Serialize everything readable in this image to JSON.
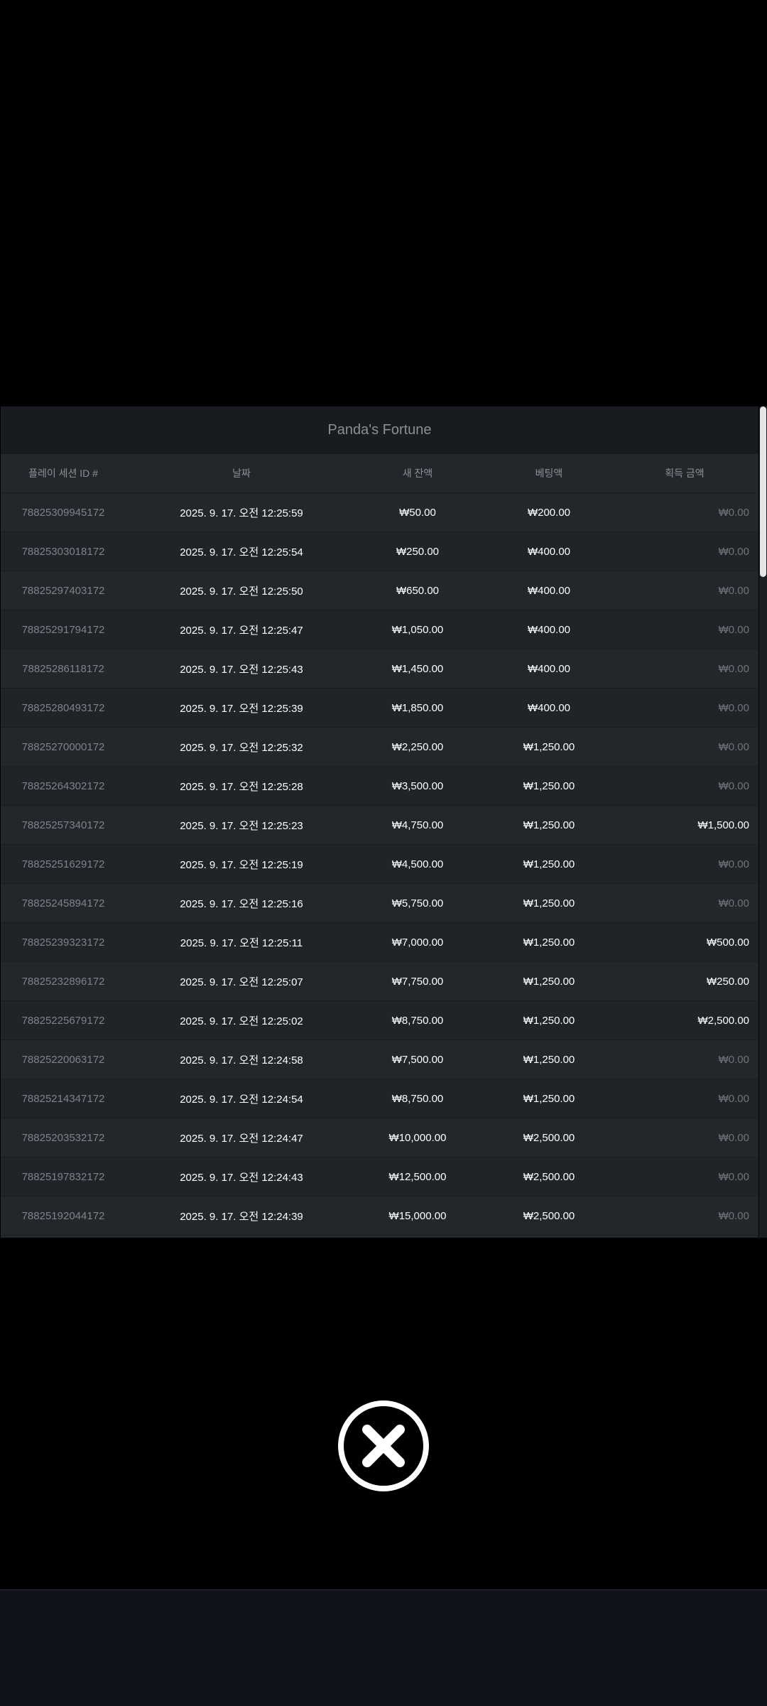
{
  "modal": {
    "title": "Panda's Fortune",
    "headers": [
      "플레이 세션 ID #",
      "날짜",
      "새 잔액",
      "베팅액",
      "획득 금액"
    ],
    "rows": [
      {
        "id": "78825309945172",
        "date": "2025. 9. 17. 오전 12:25:59",
        "balance": "₩50.00",
        "bet": "₩200.00",
        "win": "₩0.00"
      },
      {
        "id": "78825303018172",
        "date": "2025. 9. 17. 오전 12:25:54",
        "balance": "₩250.00",
        "bet": "₩400.00",
        "win": "₩0.00"
      },
      {
        "id": "78825297403172",
        "date": "2025. 9. 17. 오전 12:25:50",
        "balance": "₩650.00",
        "bet": "₩400.00",
        "win": "₩0.00"
      },
      {
        "id": "78825291794172",
        "date": "2025. 9. 17. 오전 12:25:47",
        "balance": "₩1,050.00",
        "bet": "₩400.00",
        "win": "₩0.00"
      },
      {
        "id": "78825286118172",
        "date": "2025. 9. 17. 오전 12:25:43",
        "balance": "₩1,450.00",
        "bet": "₩400.00",
        "win": "₩0.00"
      },
      {
        "id": "78825280493172",
        "date": "2025. 9. 17. 오전 12:25:39",
        "balance": "₩1,850.00",
        "bet": "₩400.00",
        "win": "₩0.00"
      },
      {
        "id": "78825270000172",
        "date": "2025. 9. 17. 오전 12:25:32",
        "balance": "₩2,250.00",
        "bet": "₩1,250.00",
        "win": "₩0.00"
      },
      {
        "id": "78825264302172",
        "date": "2025. 9. 17. 오전 12:25:28",
        "balance": "₩3,500.00",
        "bet": "₩1,250.00",
        "win": "₩0.00"
      },
      {
        "id": "78825257340172",
        "date": "2025. 9. 17. 오전 12:25:23",
        "balance": "₩4,750.00",
        "bet": "₩1,250.00",
        "win": "₩1,500.00"
      },
      {
        "id": "78825251629172",
        "date": "2025. 9. 17. 오전 12:25:19",
        "balance": "₩4,500.00",
        "bet": "₩1,250.00",
        "win": "₩0.00"
      },
      {
        "id": "78825245894172",
        "date": "2025. 9. 17. 오전 12:25:16",
        "balance": "₩5,750.00",
        "bet": "₩1,250.00",
        "win": "₩0.00"
      },
      {
        "id": "78825239323172",
        "date": "2025. 9. 17. 오전 12:25:11",
        "balance": "₩7,000.00",
        "bet": "₩1,250.00",
        "win": "₩500.00"
      },
      {
        "id": "78825232896172",
        "date": "2025. 9. 17. 오전 12:25:07",
        "balance": "₩7,750.00",
        "bet": "₩1,250.00",
        "win": "₩250.00"
      },
      {
        "id": "78825225679172",
        "date": "2025. 9. 17. 오전 12:25:02",
        "balance": "₩8,750.00",
        "bet": "₩1,250.00",
        "win": "₩2,500.00"
      },
      {
        "id": "78825220063172",
        "date": "2025. 9. 17. 오전 12:24:58",
        "balance": "₩7,500.00",
        "bet": "₩1,250.00",
        "win": "₩0.00"
      },
      {
        "id": "78825214347172",
        "date": "2025. 9. 17. 오전 12:24:54",
        "balance": "₩8,750.00",
        "bet": "₩1,250.00",
        "win": "₩0.00"
      },
      {
        "id": "78825203532172",
        "date": "2025. 9. 17. 오전 12:24:47",
        "balance": "₩10,000.00",
        "bet": "₩2,500.00",
        "win": "₩0.00"
      },
      {
        "id": "78825197832172",
        "date": "2025. 9. 17. 오전 12:24:43",
        "balance": "₩12,500.00",
        "bet": "₩2,500.00",
        "win": "₩0.00"
      },
      {
        "id": "78825192044172",
        "date": "2025. 9. 17. 오전 12:24:39",
        "balance": "₩15,000.00",
        "bet": "₩2,500.00",
        "win": "₩0.00"
      }
    ]
  },
  "close_button": {
    "icon": "close-icon"
  },
  "colors": {
    "background": "#000000",
    "panel": "#22272b",
    "title_bar": "#181b1f",
    "muted_text": "#7e838a",
    "scrollbar_thumb": "#e4e4e4"
  }
}
